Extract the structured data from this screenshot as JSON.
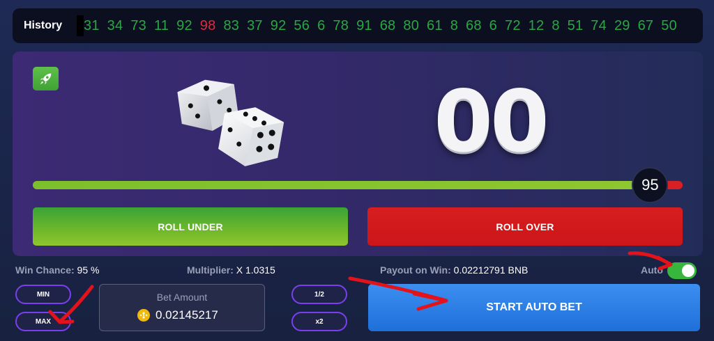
{
  "history": {
    "label": "History",
    "items": [
      {
        "v": "31",
        "c": "green"
      },
      {
        "v": "34",
        "c": "green"
      },
      {
        "v": "73",
        "c": "green"
      },
      {
        "v": "11",
        "c": "green"
      },
      {
        "v": "92",
        "c": "green"
      },
      {
        "v": "98",
        "c": "red"
      },
      {
        "v": "83",
        "c": "green"
      },
      {
        "v": "37",
        "c": "green"
      },
      {
        "v": "92",
        "c": "green"
      },
      {
        "v": "56",
        "c": "green"
      },
      {
        "v": "6",
        "c": "green"
      },
      {
        "v": "78",
        "c": "green"
      },
      {
        "v": "91",
        "c": "green"
      },
      {
        "v": "68",
        "c": "green"
      },
      {
        "v": "80",
        "c": "green"
      },
      {
        "v": "61",
        "c": "green"
      },
      {
        "v": "8",
        "c": "green"
      },
      {
        "v": "68",
        "c": "green"
      },
      {
        "v": "6",
        "c": "green"
      },
      {
        "v": "72",
        "c": "green"
      },
      {
        "v": "12",
        "c": "green"
      },
      {
        "v": "8",
        "c": "green"
      },
      {
        "v": "51",
        "c": "green"
      },
      {
        "v": "74",
        "c": "green"
      },
      {
        "v": "29",
        "c": "green"
      },
      {
        "v": "67",
        "c": "green"
      },
      {
        "v": "50",
        "c": "green"
      }
    ]
  },
  "game": {
    "result": "00",
    "target": "95",
    "target_fraction": 0.95,
    "roll_under_label": "ROLL UNDER",
    "roll_over_label": "ROLL OVER"
  },
  "stats": {
    "win_chance_label": "Win Chance:",
    "win_chance_value": "95 %",
    "multiplier_label": "Multiplier:",
    "multiplier_value": "X 1.0315",
    "payout_label": "Payout on Win:",
    "payout_value": "0.02212791 BNB",
    "auto_label": "Auto",
    "auto_enabled": true
  },
  "bet": {
    "min_label": "MIN",
    "max_label": "MAX",
    "title": "Bet Amount",
    "amount": "0.02145217",
    "half_label": "1/2",
    "double_label": "x2",
    "start_label": "START AUTO BET"
  },
  "colors": {
    "history_green": "#2aa744",
    "history_red": "#e02a3d",
    "annotation_red": "#e3131b"
  }
}
